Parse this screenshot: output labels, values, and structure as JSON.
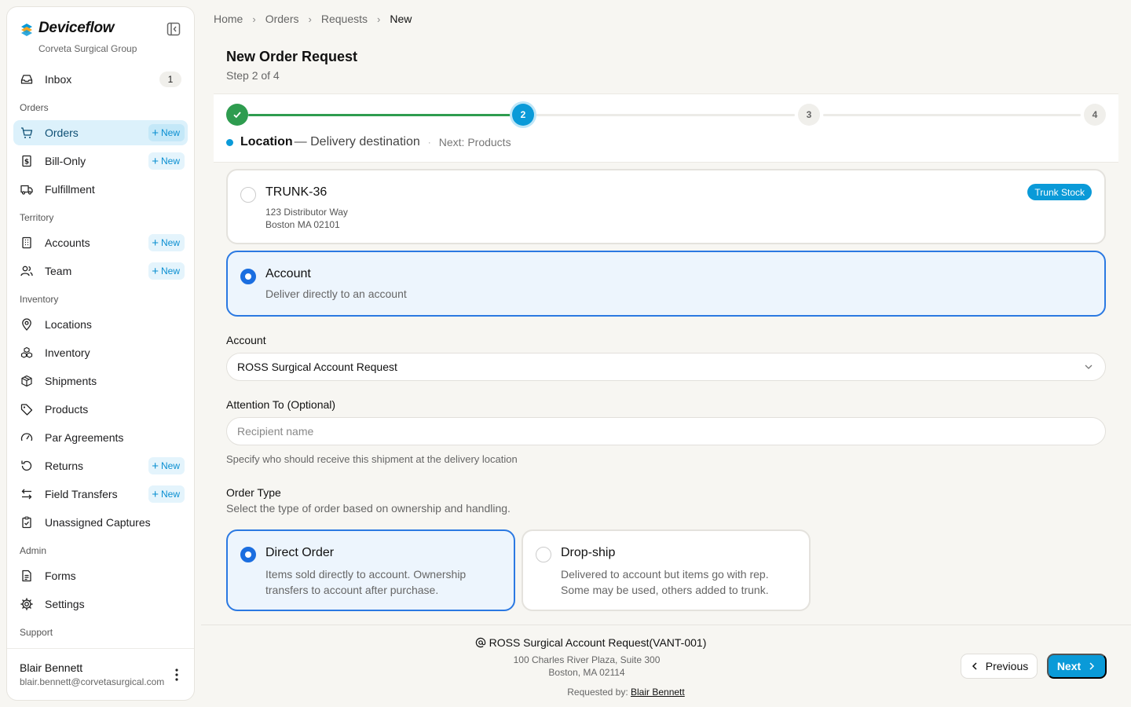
{
  "brand": {
    "name": "Deviceflow",
    "org": "Corveta Surgical Group"
  },
  "sidebar": {
    "inbox": {
      "label": "Inbox",
      "count": "1"
    },
    "sections": {
      "orders": "Orders",
      "territory": "Territory",
      "inventory": "Inventory",
      "admin": "Admin",
      "support": "Support"
    },
    "items": {
      "orders": "Orders",
      "bill_only": "Bill-Only",
      "fulfillment": "Fulfillment",
      "accounts": "Accounts",
      "team": "Team",
      "locations": "Locations",
      "inventory": "Inventory",
      "shipments": "Shipments",
      "products": "Products",
      "par_agreements": "Par Agreements",
      "returns": "Returns",
      "field_transfers": "Field Transfers",
      "unassigned_captures": "Unassigned Captures",
      "forms": "Forms",
      "settings": "Settings"
    },
    "new_label": "New",
    "user": {
      "name": "Blair Bennett",
      "email": "blair.bennett@corvetasurgical.com"
    }
  },
  "breadcrumb": [
    "Home",
    "Orders",
    "Requests",
    "New"
  ],
  "page": {
    "title": "New Order Request",
    "subtitle": "Step 2 of 4"
  },
  "stepper": {
    "current": 2,
    "total": 4,
    "step_labels": [
      "2",
      "3",
      "4"
    ],
    "current_name": "Location",
    "current_desc": "— Delivery destination",
    "separator": "·",
    "next_text": "Next: Products"
  },
  "locations": {
    "trunk": {
      "name": "TRUNK-36",
      "line1": "123 Distributor Way",
      "line2": "Boston MA 02101",
      "badge": "Trunk Stock"
    },
    "account": {
      "name": "Account",
      "desc": "Deliver directly to an account"
    }
  },
  "form": {
    "account_label": "Account",
    "account_value": "ROSS Surgical Account Request",
    "attention_label": "Attention To (Optional)",
    "attention_placeholder": "Recipient name",
    "attention_help": "Specify who should receive this shipment at the delivery location",
    "order_type_label": "Order Type",
    "order_type_help": "Select the type of order based on ownership and handling.",
    "types": {
      "direct": {
        "title": "Direct Order",
        "desc": "Items sold directly to account. Ownership transfers to account after purchase."
      },
      "dropship": {
        "title": "Drop-ship",
        "desc": "Delivered to account but items go with rep. Some may be used, others added to trunk."
      }
    }
  },
  "footer": {
    "account_name": "ROSS Surgical Account Request(VANT-001)",
    "address1": "100 Charles River Plaza, Suite 300",
    "address2": "Boston, MA 02114",
    "requested_by_label": "Requested by:",
    "requested_by": "Blair Bennett",
    "previous": "Previous",
    "next": "Next"
  },
  "colors": {
    "accent": "#0a9ad8",
    "success": "#2e9c4f",
    "selected_border": "#2b79e2"
  }
}
